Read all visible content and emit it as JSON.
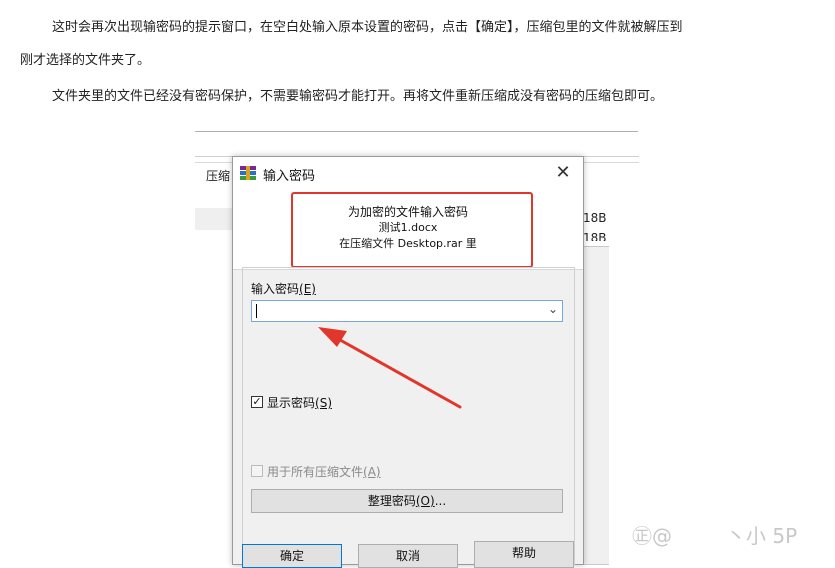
{
  "article": {
    "para1_line1": "这时会再次出现输密码的提示窗口，在空白处输入原本设置的密码，点击【确定】，压缩包里的文件就被解压到",
    "para1_line2": "刚才选择的文件夹了。",
    "para2": "文件夹里的文件已经没有密码保护，不需要输密码才能打开。再将文件重新压缩成没有密码的压缩包即可。"
  },
  "background_window": {
    "label": "压缩",
    "size_1": "18B",
    "size_2": "18B"
  },
  "dialog": {
    "title": "输入密码",
    "close_glyph": "✕",
    "info_line1": "为加密的文件输入密码",
    "info_line2": "测试1.docx",
    "info_line3": "在压缩文件 Desktop.rar 里",
    "password_label": "输入密码",
    "password_accel": "(E)",
    "password_value": "",
    "show_password_label": "显示密码",
    "show_password_accel": "(S)",
    "show_password_checked": true,
    "all_archives_label": "用于所有压缩文件",
    "all_archives_accel": "(A)",
    "all_archives_checked": false,
    "organize_label": "整理密码",
    "organize_accel": "(O)",
    "organize_suffix": "...",
    "ok_label": "确定",
    "cancel_label": "取消",
    "help_label": "帮助"
  },
  "annotation_color": "#e0362c",
  "watermark": {
    "left": "㊣@",
    "right": "丶小  5P"
  }
}
